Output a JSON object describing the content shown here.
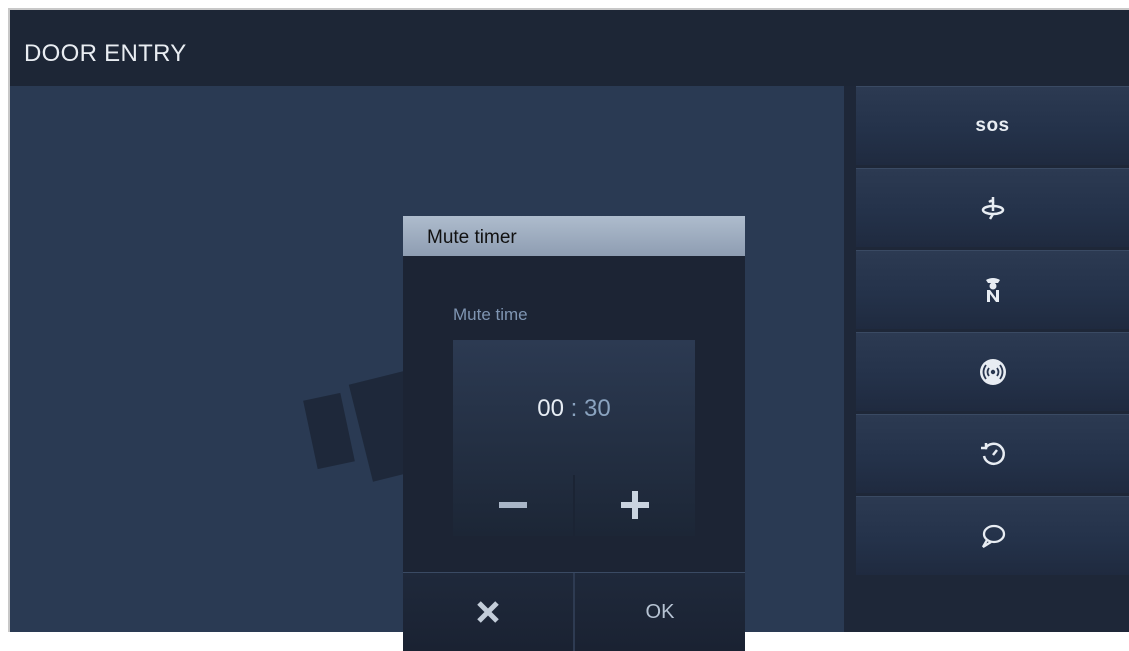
{
  "header": {
    "title": "DOOR ENTRY"
  },
  "sidebar": {
    "buttons": [
      {
        "label": "SOS",
        "icon": "sos-icon"
      },
      {
        "label": "",
        "icon": "rotate-lock-icon"
      },
      {
        "label": "",
        "icon": "guard-icon"
      },
      {
        "label": "",
        "icon": "alarm-icon"
      },
      {
        "label": "",
        "icon": "history-icon"
      },
      {
        "label": "",
        "icon": "message-icon"
      }
    ]
  },
  "dialog": {
    "title": "Mute timer",
    "field_label": "Mute time",
    "time": {
      "minutes": "00",
      "separator": ":",
      "seconds": "30"
    },
    "minus_label": "−",
    "plus_label": "+",
    "cancel_icon": "close-icon",
    "ok_label": "OK"
  },
  "colors": {
    "background": "#1f2939",
    "main_panel": "#2a3a53",
    "dialog_header": "#9fb0c4",
    "accent_text": "#8aa3bf"
  }
}
